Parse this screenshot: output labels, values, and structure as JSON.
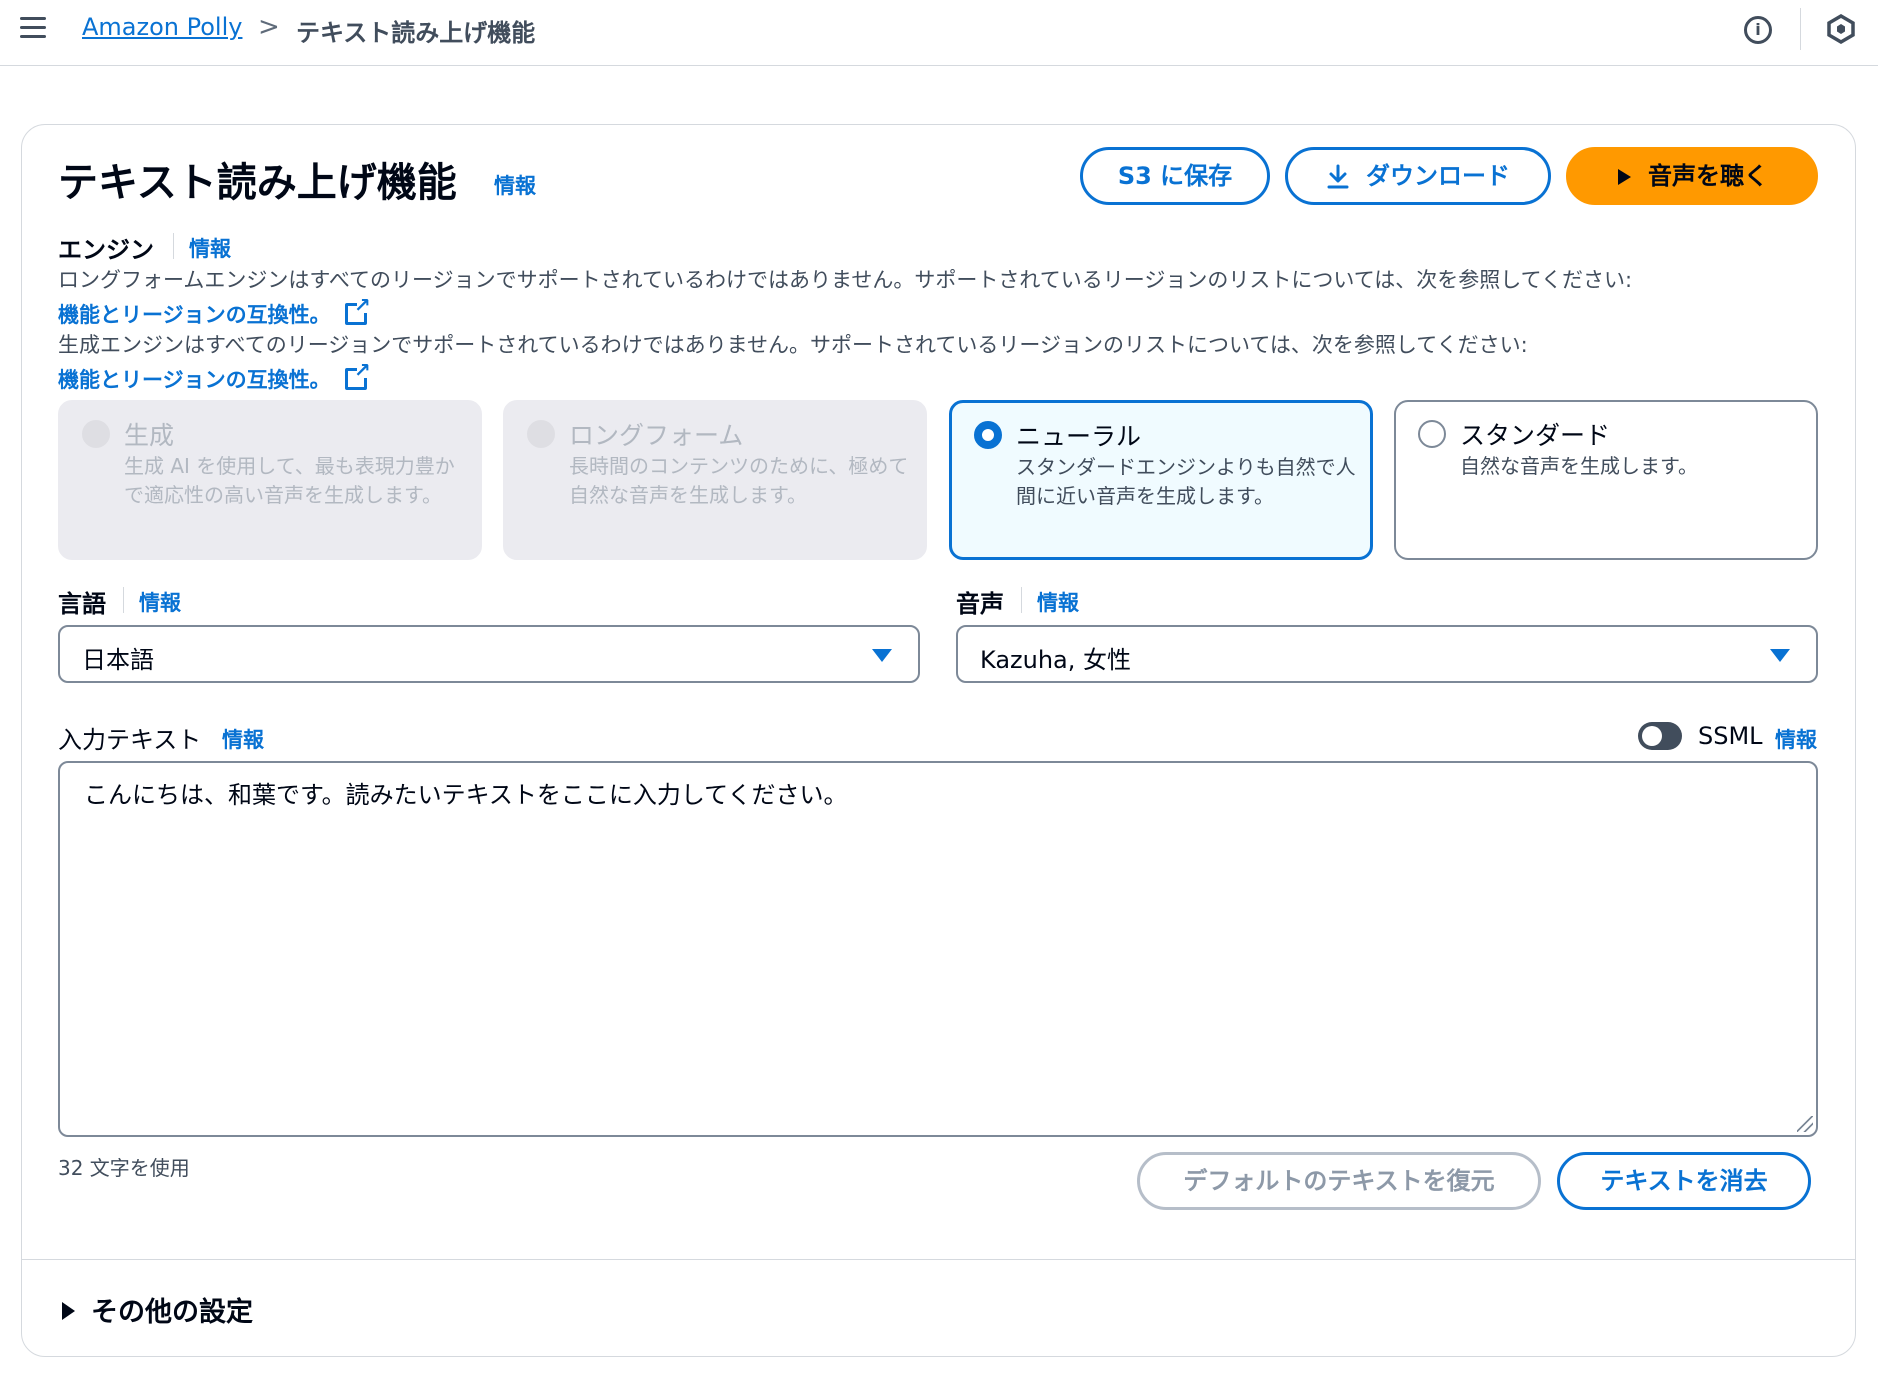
{
  "breadcrumb": {
    "root": "Amazon Polly",
    "separator": ">",
    "current": "テキスト読み上げ機能"
  },
  "header": {
    "title": "テキスト読み上げ機能",
    "info": "情報",
    "save_s3": "S3 に保存",
    "download": "ダウンロード",
    "listen": "音声を聴く"
  },
  "engine": {
    "label": "エンジン",
    "info": "情報",
    "longform_note": "ロングフォームエンジンはすべてのリージョンでサポートされているわけではありません。サポートされているリージョンのリストについては、次を参照してください:",
    "generative_note": "生成エンジンはすべてのリージョンでサポートされているわけではありません。サポートされているリージョンのリストについては、次を参照してください:",
    "link_text": "機能とリージョンの互換性。",
    "options": [
      {
        "title": "生成",
        "desc": "生成 AI を使用して、最も表現力豊かで適応性の高い音声を生成します。",
        "state": "disabled"
      },
      {
        "title": "ロングフォーム",
        "desc": "長時間のコンテンツのために、極めて自然な音声を生成します。",
        "state": "disabled"
      },
      {
        "title": "ニューラル",
        "desc": "スタンダードエンジンよりも自然で人間に近い音声を生成します。",
        "state": "selected"
      },
      {
        "title": "スタンダード",
        "desc": "自然な音声を生成します。",
        "state": "normal"
      }
    ]
  },
  "language": {
    "label": "言語",
    "info": "情報",
    "value": "日本語"
  },
  "voice": {
    "label": "音声",
    "info": "情報",
    "value": "Kazuha, 女性"
  },
  "input": {
    "label": "入力テキスト",
    "info": "情報",
    "ssml_label": "SSML",
    "ssml_info": "情報",
    "ssml_enabled": false,
    "text": "こんにちは、和葉です。読みたいテキストをここに入力してください。",
    "char_count": "32 文字を使用",
    "restore": "デフォルトのテキストを復元",
    "clear": "テキストを消去"
  },
  "more_settings": {
    "label": "その他の設定"
  },
  "colors": {
    "accent": "#0972d3",
    "primary_button": "#ff9900"
  }
}
